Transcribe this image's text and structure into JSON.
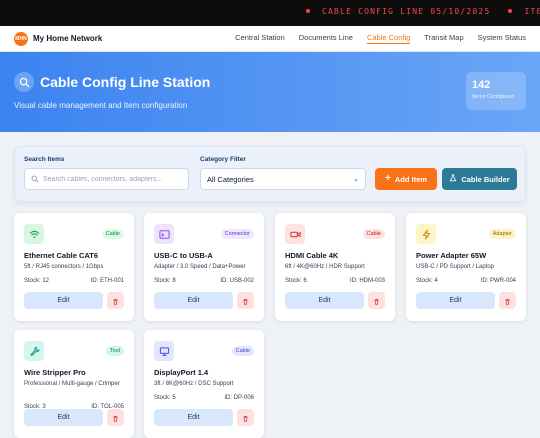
{
  "ticker": {
    "items": [
      "CABLE CONFIG LINE 05/10/2025",
      "ITEM SEARCH"
    ]
  },
  "nav": {
    "logo_text": "MHN",
    "brand": "My Home Network",
    "links": [
      "Central Station",
      "Documents Line",
      "Cable Config",
      "Transit Map",
      "System Status"
    ],
    "active_index": 2
  },
  "hero": {
    "title": "Cable Config Line Station",
    "subtitle": "Visual cable management and Item configuration",
    "stat_value": "142",
    "stat_label": "Items Configured"
  },
  "filters": {
    "search_label": "Search Items",
    "search_placeholder": "Search cables, connectors, adapters...",
    "category_label": "Category Filter",
    "category_selected": "All Categories",
    "add_label": "Add Item",
    "builder_label": "Cable Builder"
  },
  "cards": [
    {
      "icon": "wifi-icon",
      "icon_bg": "#d9f5e3",
      "icon_color": "#16a34a",
      "badge": "Cable",
      "badge_bg": "#dcfce7",
      "badge_color": "#15803d",
      "title": "Ethernet Cable CAT6",
      "desc": "5ft / RJ45 connectors / 1Gbps",
      "stock": "Stock: 12",
      "id": "ID: ETH-001",
      "edit": "Edit"
    },
    {
      "icon": "terminal-icon",
      "icon_bg": "#ede4fb",
      "icon_color": "#7c3aed",
      "badge": "Connector",
      "badge_bg": "#ede9fe",
      "badge_color": "#6d28d9",
      "title": "USB-C to USB-A",
      "desc": "Adapter / 3.0 Speed / Data+Power",
      "stock": "Stock: 8",
      "id": "ID: USB-002",
      "edit": "Edit"
    },
    {
      "icon": "video-icon",
      "icon_bg": "#fde2e2",
      "icon_color": "#dc2626",
      "badge": "Cable",
      "badge_bg": "#fee2e2",
      "badge_color": "#b91c1c",
      "title": "HDMI Cable 4K",
      "desc": "6ft / 4K@60Hz / HDR Support",
      "stock": "Stock: 6",
      "id": "ID: HDM-003",
      "edit": "Edit"
    },
    {
      "icon": "bolt-icon",
      "icon_bg": "#fdf4c8",
      "icon_color": "#ca8a04",
      "badge": "Adapter",
      "badge_bg": "#fef3c7",
      "badge_color": "#a16207",
      "title": "Power Adapter 65W",
      "desc": "USB-C / PD Support / Laptop",
      "stock": "Stock: 4",
      "id": "ID: PWR-004",
      "edit": "Edit"
    },
    {
      "icon": "wrench-icon",
      "icon_bg": "#d5f5ef",
      "icon_color": "#0d9488",
      "badge": "Tool",
      "badge_bg": "#d1fae5",
      "badge_color": "#047857",
      "title": "Wire Stripper Pro",
      "desc": "Professional / Multi-gauge / Crimper",
      "stock": "Stock: 3",
      "id": "ID: TOL-005",
      "edit": "Edit"
    },
    {
      "icon": "monitor-icon",
      "icon_bg": "#e0e7fb",
      "icon_color": "#4f46e5",
      "badge": "Cable",
      "badge_bg": "#e0e7ff",
      "badge_color": "#4338ca",
      "title": "DisplayPort 1.4",
      "desc": "3ft / 8K@60Hz / DSC Support",
      "stock": "Stock: 5",
      "id": "ID: DP-006",
      "edit": "Edit"
    }
  ]
}
